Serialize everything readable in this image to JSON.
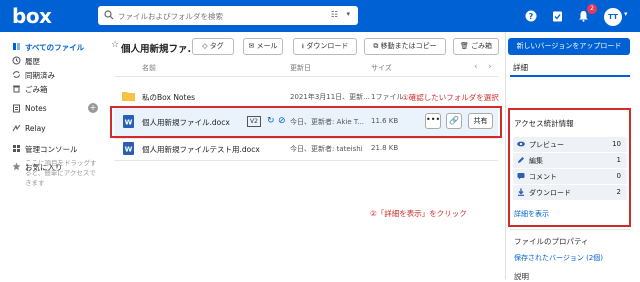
{
  "app": {
    "logo": "box"
  },
  "search": {
    "placeholder": "ファイルおよびフォルダを検索",
    "filter_icon": "filter-icon"
  },
  "topbar": {
    "notification_count": "2",
    "avatar_initials": "TT"
  },
  "sidebar": {
    "items": [
      {
        "label": "すべてのファイル",
        "icon": "folder-icon",
        "active": true
      },
      {
        "label": "履歴",
        "icon": "clock-icon"
      },
      {
        "label": "同期済み",
        "icon": "sync-icon"
      },
      {
        "label": "ごみ箱",
        "icon": "trash-icon"
      },
      {
        "label": "Notes",
        "icon": "notes-icon"
      },
      {
        "label": "Relay",
        "icon": "relay-icon"
      },
      {
        "label": "管理コンソール",
        "icon": "admin-icon"
      },
      {
        "label": "お気に入り",
        "icon": "star-icon"
      }
    ],
    "favorites_hint": "ここに項目をドラッグすると、簡単にアクセスできます"
  },
  "header": {
    "title": "個人用新規ファ...",
    "buttons": {
      "tag": "タグ",
      "mail": "メール",
      "download": "ダウンロード",
      "move_copy": "移動またはコピー",
      "trash": "ごみ箱"
    },
    "upload_version": "新しいバージョンをアップロード"
  },
  "columns": {
    "name": "名前",
    "updated": "更新日",
    "size": "サイズ"
  },
  "files": [
    {
      "name": "私のBox Notes",
      "updated": "2021年3月11日、更新...",
      "size": "1ファイル"
    },
    {
      "name": "個人用新規ファイル.docx",
      "version": "V2",
      "updated": "今日、更新者: Akie T...",
      "size": "11.6 KB",
      "share": "共有"
    },
    {
      "name": "個人用新規ファイルテスト用.docx",
      "updated": "今日、更新者: tateishi",
      "size": "21.8 KB"
    }
  ],
  "annotations": {
    "step1": "①確認したいフォルダを選択",
    "step2": "②「詳細を表示」をクリック"
  },
  "details": {
    "tab": "詳細",
    "stats_title": "アクセス統計情報",
    "stats": [
      {
        "label": "プレビュー",
        "value": "10",
        "icon": "eye-icon"
      },
      {
        "label": "編集",
        "value": "1",
        "icon": "pencil-icon"
      },
      {
        "label": "コメント",
        "value": "0",
        "icon": "comment-icon"
      },
      {
        "label": "ダウンロード",
        "value": "2",
        "icon": "download-icon"
      }
    ],
    "show_details": "詳細を表示",
    "file_properties": "ファイルのプロパティ",
    "saved_versions": "保存されたバージョン (2個)",
    "description": "説明"
  },
  "colors": {
    "brand": "#0061d5",
    "annotation": "#d12b2b"
  }
}
